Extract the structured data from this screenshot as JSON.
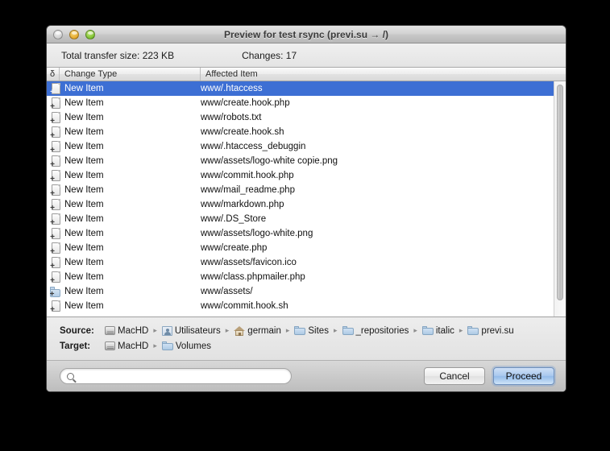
{
  "window": {
    "title": "Preview for test rsync (previ.su → /)",
    "traffic_lights": [
      "close-button",
      "minimize-button",
      "zoom-button"
    ]
  },
  "summary": {
    "transfer_size_label": "Total transfer size: 223 KB",
    "changes_label": "Changes: 17"
  },
  "list": {
    "columns": [
      "δ",
      "Change Type",
      "Affected Item"
    ],
    "rows": [
      {
        "icon": "document-add-icon",
        "change_type": "New Item",
        "affected_item": "www/.htaccess",
        "selected": true
      },
      {
        "icon": "document-add-icon",
        "change_type": "New Item",
        "affected_item": "www/create.hook.php",
        "selected": false
      },
      {
        "icon": "document-add-icon",
        "change_type": "New Item",
        "affected_item": "www/robots.txt",
        "selected": false
      },
      {
        "icon": "document-add-icon",
        "change_type": "New Item",
        "affected_item": "www/create.hook.sh",
        "selected": false
      },
      {
        "icon": "document-add-icon",
        "change_type": "New Item",
        "affected_item": "www/.htaccess_debuggin",
        "selected": false
      },
      {
        "icon": "document-add-icon",
        "change_type": "New Item",
        "affected_item": "www/assets/logo-white copie.png",
        "selected": false
      },
      {
        "icon": "document-add-icon",
        "change_type": "New Item",
        "affected_item": "www/commit.hook.php",
        "selected": false
      },
      {
        "icon": "document-add-icon",
        "change_type": "New Item",
        "affected_item": "www/mail_readme.php",
        "selected": false
      },
      {
        "icon": "document-add-icon",
        "change_type": "New Item",
        "affected_item": "www/markdown.php",
        "selected": false
      },
      {
        "icon": "document-add-icon",
        "change_type": "New Item",
        "affected_item": "www/.DS_Store",
        "selected": false
      },
      {
        "icon": "document-add-icon",
        "change_type": "New Item",
        "affected_item": "www/assets/logo-white.png",
        "selected": false
      },
      {
        "icon": "document-add-icon",
        "change_type": "New Item",
        "affected_item": "www/create.php",
        "selected": false
      },
      {
        "icon": "document-add-icon",
        "change_type": "New Item",
        "affected_item": "www/assets/favicon.ico",
        "selected": false
      },
      {
        "icon": "document-add-icon",
        "change_type": "New Item",
        "affected_item": "www/class.phpmailer.php",
        "selected": false
      },
      {
        "icon": "folder-add-icon",
        "change_type": "New Item",
        "affected_item": "www/assets/",
        "selected": false
      },
      {
        "icon": "document-add-icon",
        "change_type": "New Item",
        "affected_item": "www/commit.hook.sh",
        "selected": false
      }
    ]
  },
  "paths": {
    "source": {
      "label": "Source:",
      "crumbs": [
        {
          "icon": "harddisk-icon",
          "name": "MacHD"
        },
        {
          "icon": "users-folder-icon",
          "name": "Utilisateurs"
        },
        {
          "icon": "home-icon",
          "name": "germain"
        },
        {
          "icon": "folder-icon",
          "name": "Sites"
        },
        {
          "icon": "folder-icon",
          "name": "_repositories"
        },
        {
          "icon": "folder-icon",
          "name": "italic"
        },
        {
          "icon": "folder-icon",
          "name": "previ.su"
        }
      ]
    },
    "target": {
      "label": "Target:",
      "crumbs": [
        {
          "icon": "harddisk-icon",
          "name": "MacHD"
        },
        {
          "icon": "folder-icon",
          "name": "Volumes"
        }
      ]
    },
    "separator": "▸"
  },
  "bottom": {
    "search_value": "",
    "search_placeholder": "",
    "cancel_label": "Cancel",
    "proceed_label": "Proceed"
  },
  "colors": {
    "selection_blue": "#3d6fd4",
    "default_button_blue": "#a9c8ee",
    "window_chrome": "#e8e8e8"
  }
}
